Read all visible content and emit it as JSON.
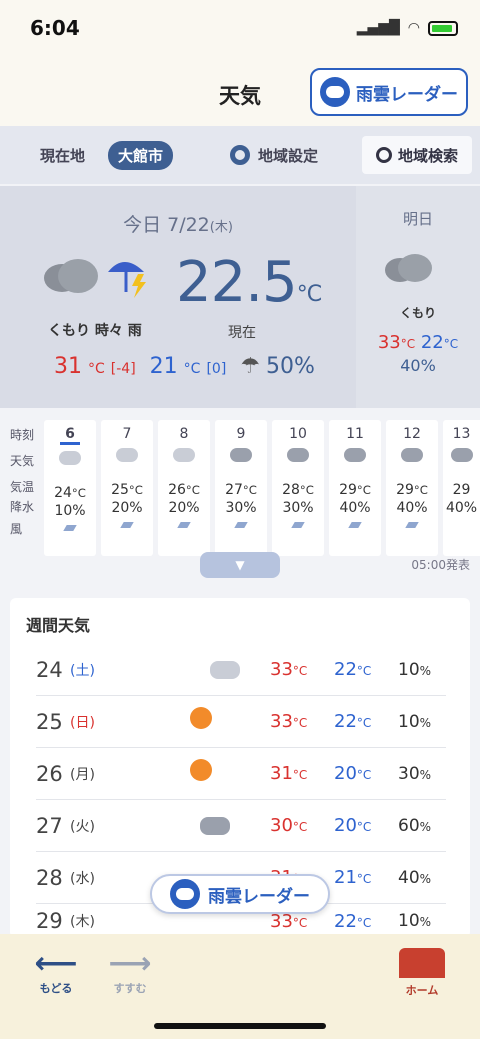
{
  "status": {
    "time": "6:04"
  },
  "header": {
    "title": "天気",
    "radar_label": "雨雲レーダー"
  },
  "locbar": {
    "current": "現在地",
    "city": "大館市",
    "settings": "地域設定",
    "search": "地域検索"
  },
  "today": {
    "date": "今日 7/22",
    "dow": "(木)",
    "condition": "くもり 時々 雨",
    "temp": "22.5",
    "temp_unit": "°C",
    "now_label": "現在",
    "high": "31",
    "high_diff": "[-4]",
    "low": "21",
    "low_diff": "[0]",
    "pop": "50%",
    "deg": "°C"
  },
  "tomorrow": {
    "label": "明日",
    "condition": "くもり",
    "high": "33",
    "low": "22",
    "pop": "40%",
    "deg": "°C"
  },
  "hourly": {
    "row_labels": [
      "時刻",
      "天気",
      "気温",
      "降水",
      "風"
    ],
    "hours": [
      {
        "h": "6",
        "t": "24",
        "p": "10%"
      },
      {
        "h": "7",
        "t": "25",
        "p": "20%"
      },
      {
        "h": "8",
        "t": "26",
        "p": "20%"
      },
      {
        "h": "9",
        "t": "27",
        "p": "30%"
      },
      {
        "h": "10",
        "t": "28",
        "p": "30%"
      },
      {
        "h": "11",
        "t": "29",
        "p": "40%"
      },
      {
        "h": "12",
        "t": "29",
        "p": "40%"
      },
      {
        "h": "13",
        "t": "29",
        "p": "40%"
      }
    ],
    "issued": "05:00発表"
  },
  "weekly": {
    "title": "週間天気",
    "days": [
      {
        "d": "24",
        "dw": "(土)",
        "hi": "33",
        "lo": "22",
        "pop": "10"
      },
      {
        "d": "25",
        "dw": "(日)",
        "hi": "33",
        "lo": "22",
        "pop": "10"
      },
      {
        "d": "26",
        "dw": "(月)",
        "hi": "31",
        "lo": "20",
        "pop": "30"
      },
      {
        "d": "27",
        "dw": "(火)",
        "hi": "30",
        "lo": "20",
        "pop": "60"
      },
      {
        "d": "28",
        "dw": "(水)",
        "hi": "31",
        "lo": "21",
        "pop": "40"
      },
      {
        "d": "29",
        "dw": "(木)",
        "hi": "33",
        "lo": "22",
        "pop": "10"
      }
    ],
    "deg": "°C",
    "pct": "%"
  },
  "float_radar": "雨雲レーダー",
  "footer": {
    "back": "もどる",
    "forward": "すすむ",
    "home": "ホーム"
  }
}
